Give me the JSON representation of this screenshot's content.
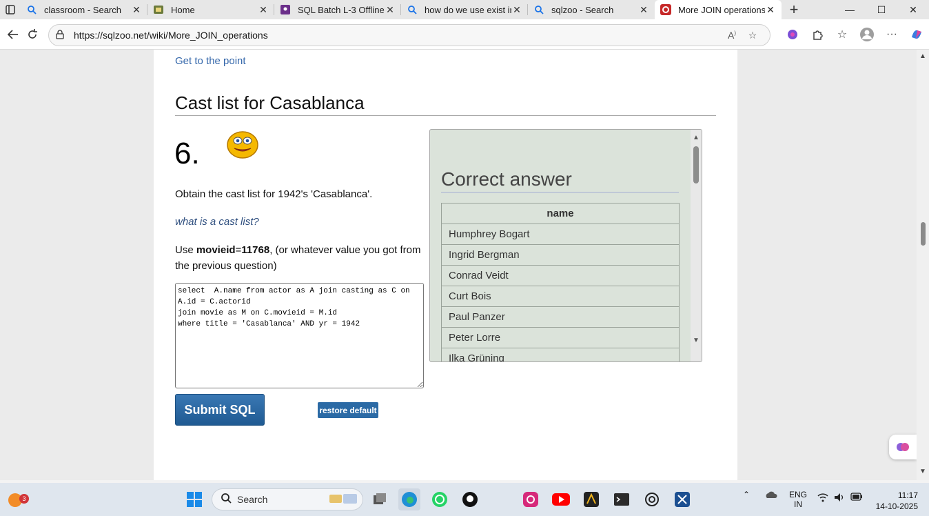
{
  "browser": {
    "tabs": [
      {
        "title": "classroom - Search",
        "icon": "search-icon"
      },
      {
        "title": "Home",
        "icon": "home-app-icon"
      },
      {
        "title": "SQL Batch L-3 Offline /",
        "icon": "class-app-icon"
      },
      {
        "title": "how do we use exist in",
        "icon": "search-icon"
      },
      {
        "title": "sqlzoo - Search",
        "icon": "search-icon"
      },
      {
        "title": "More JOIN operations",
        "icon": "sqlzoo-icon",
        "active": true
      }
    ],
    "url": "https://sqlzoo.net/wiki/More_JOIN_operations"
  },
  "page": {
    "top_link": "Get to the point",
    "section_title": "Cast list for Casablanca",
    "question_number": "6.",
    "instruction": "Obtain the cast list for 1942's 'Casablanca'.",
    "hint_link": "what is a cast list?",
    "use_prefix": "Use ",
    "use_bold_key": "movieid",
    "use_equals": "=",
    "use_bold_value": "11768",
    "use_suffix": ", (or whatever value you got from the previous question)",
    "sql": "select  A.name from actor as A join casting as C on A.id = C.actorid\njoin movie as M on C.movieid = M.id\nwhere title = 'Casablanca' AND yr = 1942",
    "submit_label": "Submit SQL",
    "restore_label": "restore default"
  },
  "answer": {
    "heading": "Correct answer",
    "column": "name",
    "rows": [
      "Humphrey Bogart",
      "Ingrid Bergman",
      "Conrad Veidt",
      "Curt Bois",
      "Paul Panzer",
      "Peter Lorre",
      "Ilka Grüning"
    ]
  },
  "taskbar": {
    "search_placeholder": "Search",
    "notification_count": "3",
    "lang_top": "ENG",
    "lang_bottom": "IN",
    "time": "11:17",
    "date": "14-10-2025"
  }
}
